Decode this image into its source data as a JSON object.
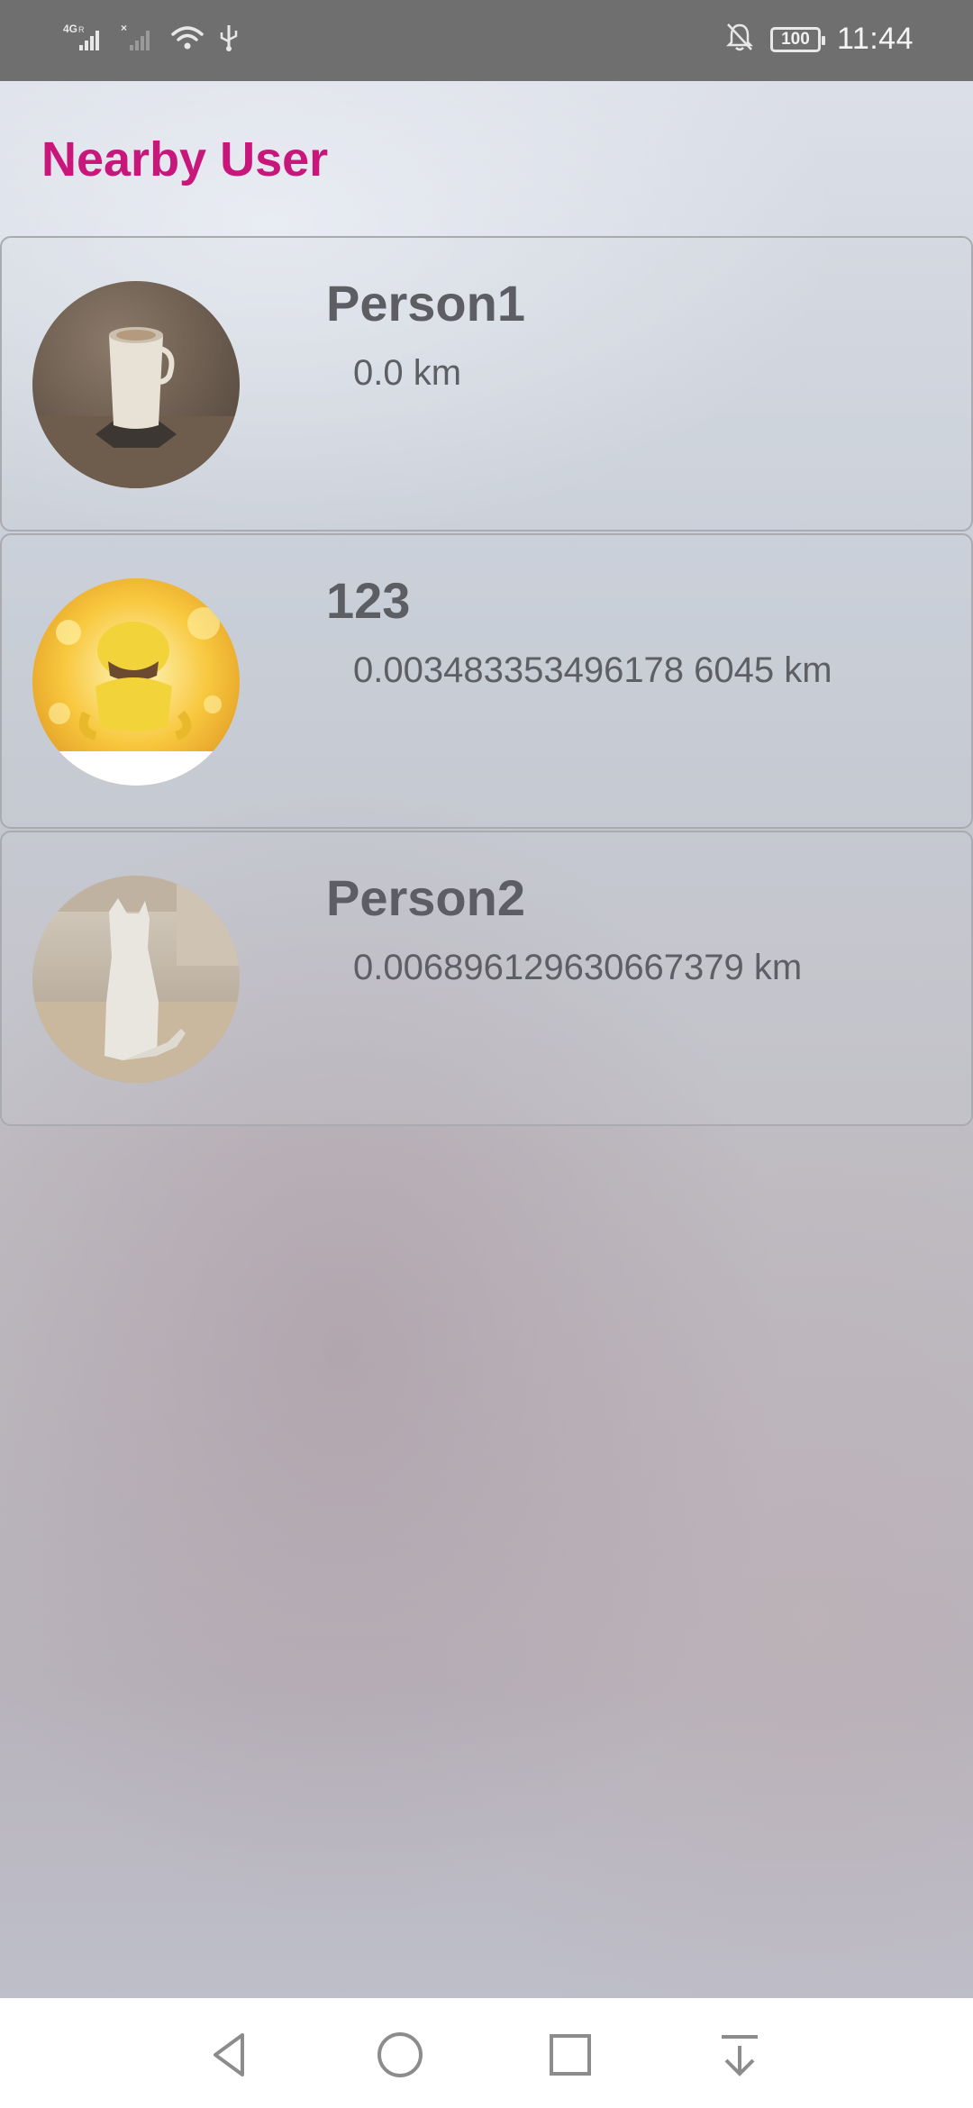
{
  "status_bar": {
    "network_label": "4G",
    "time": "11:44",
    "battery": "100",
    "icons": [
      "signal-4g-icon",
      "signal-no-sim-icon",
      "wifi-icon",
      "usb-icon",
      "notifications-off-icon",
      "battery-icon"
    ]
  },
  "header": {
    "title": "Nearby User"
  },
  "users": [
    {
      "name": "Person1",
      "distance": "0.0 km",
      "avatar": "coffee-cup-photo"
    },
    {
      "name": "123",
      "distance": "0.003483353496178 6045 km",
      "avatar": "yellow-pokemon-photo"
    },
    {
      "name": "Person2",
      "distance": "0.006896129630667379 km",
      "avatar": "paper-cat-photo"
    }
  ],
  "nav_bar": {
    "icons": [
      "back-icon",
      "home-icon",
      "recents-icon",
      "notification-shade-icon"
    ]
  },
  "colors": {
    "accent": "#c8167a",
    "text": "#5d5e63",
    "status_bar": "#6f6f70"
  }
}
